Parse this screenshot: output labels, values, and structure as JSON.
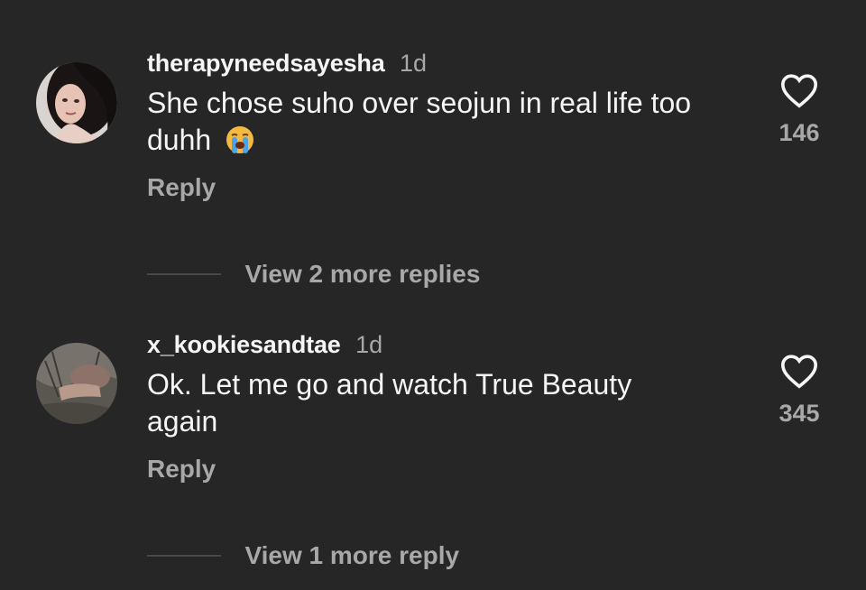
{
  "comments": [
    {
      "username": "therapyneedsayesha",
      "time": "1d",
      "text": "She chose suho over seojun in real life too duhh",
      "emoji": "loudly-crying-face",
      "reply_label": "Reply",
      "like_count": "146",
      "view_replies": "View 2 more replies"
    },
    {
      "username": "x_kookiesandtae",
      "time": "1d",
      "text": "Ok. Let me go and watch True Beauty again",
      "reply_label": "Reply",
      "like_count": "345",
      "view_replies": "View 1 more reply"
    }
  ],
  "colors": {
    "background": "#262626",
    "primary_text": "#f5f5f5",
    "secondary_text": "#a8a8a8"
  }
}
